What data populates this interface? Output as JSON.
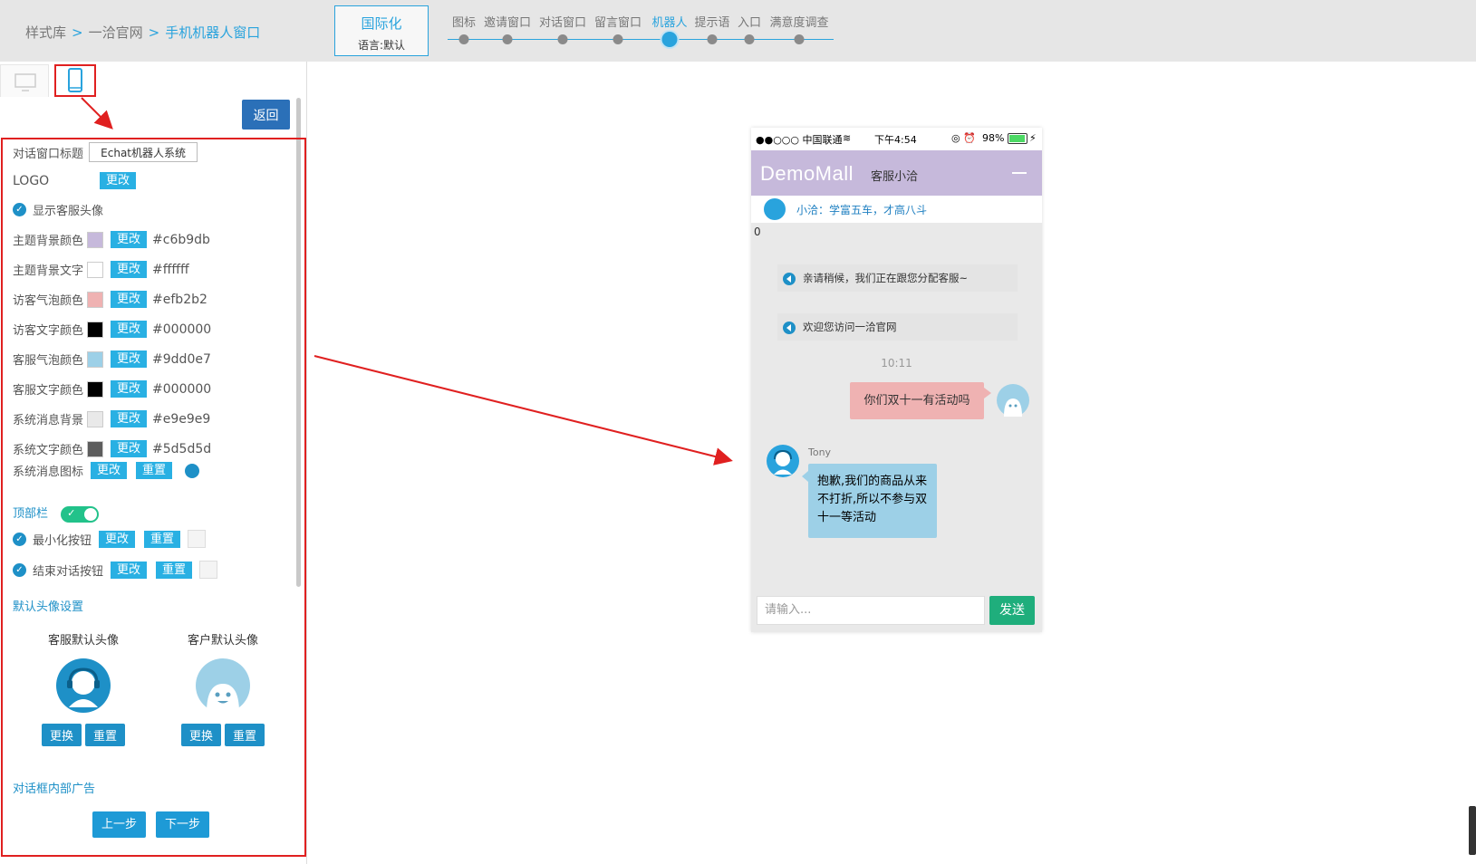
{
  "breadcrumb": {
    "items": [
      "样式库",
      "一洽官网"
    ],
    "separator": ">",
    "current": "手机机器人窗口"
  },
  "intl": {
    "title": "国际化",
    "language": "语言:默认"
  },
  "steps": [
    {
      "label": "图标",
      "active": false
    },
    {
      "label": "邀请窗口",
      "active": false
    },
    {
      "label": "对话窗口",
      "active": false
    },
    {
      "label": "留言窗口",
      "active": false
    },
    {
      "label": "机器人",
      "active": true
    },
    {
      "label": "提示语",
      "active": false
    },
    {
      "label": "入口",
      "active": false
    },
    {
      "label": "满意度调查",
      "active": false
    }
  ],
  "device_tabs": {
    "desktop_icon": "monitor-icon",
    "mobile_icon": "phone-icon"
  },
  "back_label": "返回",
  "settings": {
    "chat_title_label": "对话窗口标题",
    "chat_title_value": "Echat机器人系统",
    "logo_label": "LOGO",
    "change_label": "更改",
    "reset_label": "重置",
    "show_avatar_label": "显示客服头像",
    "colors": [
      {
        "label": "主题背景颜色",
        "hex": "#c6b9db"
      },
      {
        "label": "主题背景文字",
        "hex": "#ffffff"
      },
      {
        "label": "访客气泡颜色",
        "hex": "#efb2b2"
      },
      {
        "label": "访客文字颜色",
        "hex": "#000000"
      },
      {
        "label": "客服气泡颜色",
        "hex": "#9dd0e7"
      },
      {
        "label": "客服文字颜色",
        "hex": "#000000"
      },
      {
        "label": "系统消息背景",
        "hex": "#e9e9e9"
      },
      {
        "label": "系统文字颜色",
        "hex": "#5d5d5d"
      }
    ],
    "sys_icon_label": "系统消息图标",
    "topbar_label": "顶部栏",
    "minimize_label": "最小化按钮",
    "end_chat_label": "结束对话按钮",
    "default_avatar_title": "默认头像设置",
    "agent_avatar_label": "客服默认头像",
    "customer_avatar_label": "客户默认头像",
    "replace_label": "更换",
    "ad_title": "对话框内部广告",
    "prev_label": "上一步",
    "next_label": "下一步"
  },
  "phone": {
    "status": {
      "carrier": "●●○○○ 中国联通",
      "time": "下午4:54",
      "battery": "98%"
    },
    "brand": "DemoMall",
    "chat_title": "客服小洽",
    "notice": "小洽：学富五车，才高八斗",
    "counter": "0",
    "system_messages": [
      "亲请稍候，我们正在跟您分配客服~",
      "欢迎您访问一洽官网"
    ],
    "timestamp": "10:11",
    "visitor_message": "你们双十一有活动吗",
    "agent_name": "Tony",
    "agent_message": "抱歉,我们的商品从来不打折,所以不参与双十一等活动",
    "input_placeholder": "请输入...",
    "send_label": "发送"
  },
  "colors": {
    "accent": "#29a3dd",
    "annotation": "#e02020",
    "theme_bg": "#c6b9db"
  }
}
